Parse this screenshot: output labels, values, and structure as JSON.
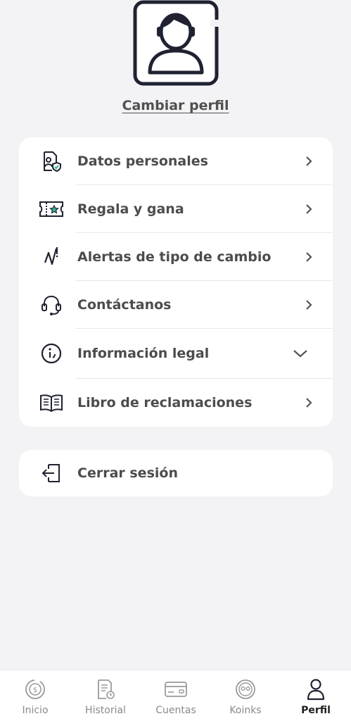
{
  "profile": {
    "change_label": "Cambiar perfil",
    "avatar_icon": "user-avatar-icon"
  },
  "menu": {
    "items": [
      {
        "label": "Datos personales",
        "icon": "personal-data-icon",
        "indicator": "chevron-right"
      },
      {
        "label": "Regala y gana",
        "icon": "gift-ticket-icon",
        "indicator": "chevron-right"
      },
      {
        "label": "Alertas de tipo de cambio",
        "icon": "exchange-alert-icon",
        "indicator": "chevron-right"
      },
      {
        "label": "Contáctanos",
        "icon": "headset-icon",
        "indicator": "chevron-right"
      },
      {
        "label": "Información legal",
        "icon": "info-icon",
        "indicator": "chevron-down"
      },
      {
        "label": "Libro de reclamaciones",
        "icon": "book-icon",
        "indicator": "chevron-right"
      }
    ]
  },
  "logout": {
    "label": "Cerrar sesión",
    "icon": "logout-icon"
  },
  "tabbar": {
    "tabs": [
      {
        "label": "Inicio",
        "icon": "home-coin-icon",
        "active": false
      },
      {
        "label": "Historial",
        "icon": "history-icon",
        "active": false
      },
      {
        "label": "Cuentas",
        "icon": "card-icon",
        "active": false
      },
      {
        "label": "Koinks",
        "icon": "koinks-icon",
        "active": false
      },
      {
        "label": "Perfil",
        "icon": "profile-icon",
        "active": true
      }
    ]
  },
  "colors": {
    "background": "#f3f3f5",
    "card": "#ffffff",
    "text": "#4c4c4c",
    "accent": "#2fb59a",
    "icon_dark": "#1f2230"
  }
}
